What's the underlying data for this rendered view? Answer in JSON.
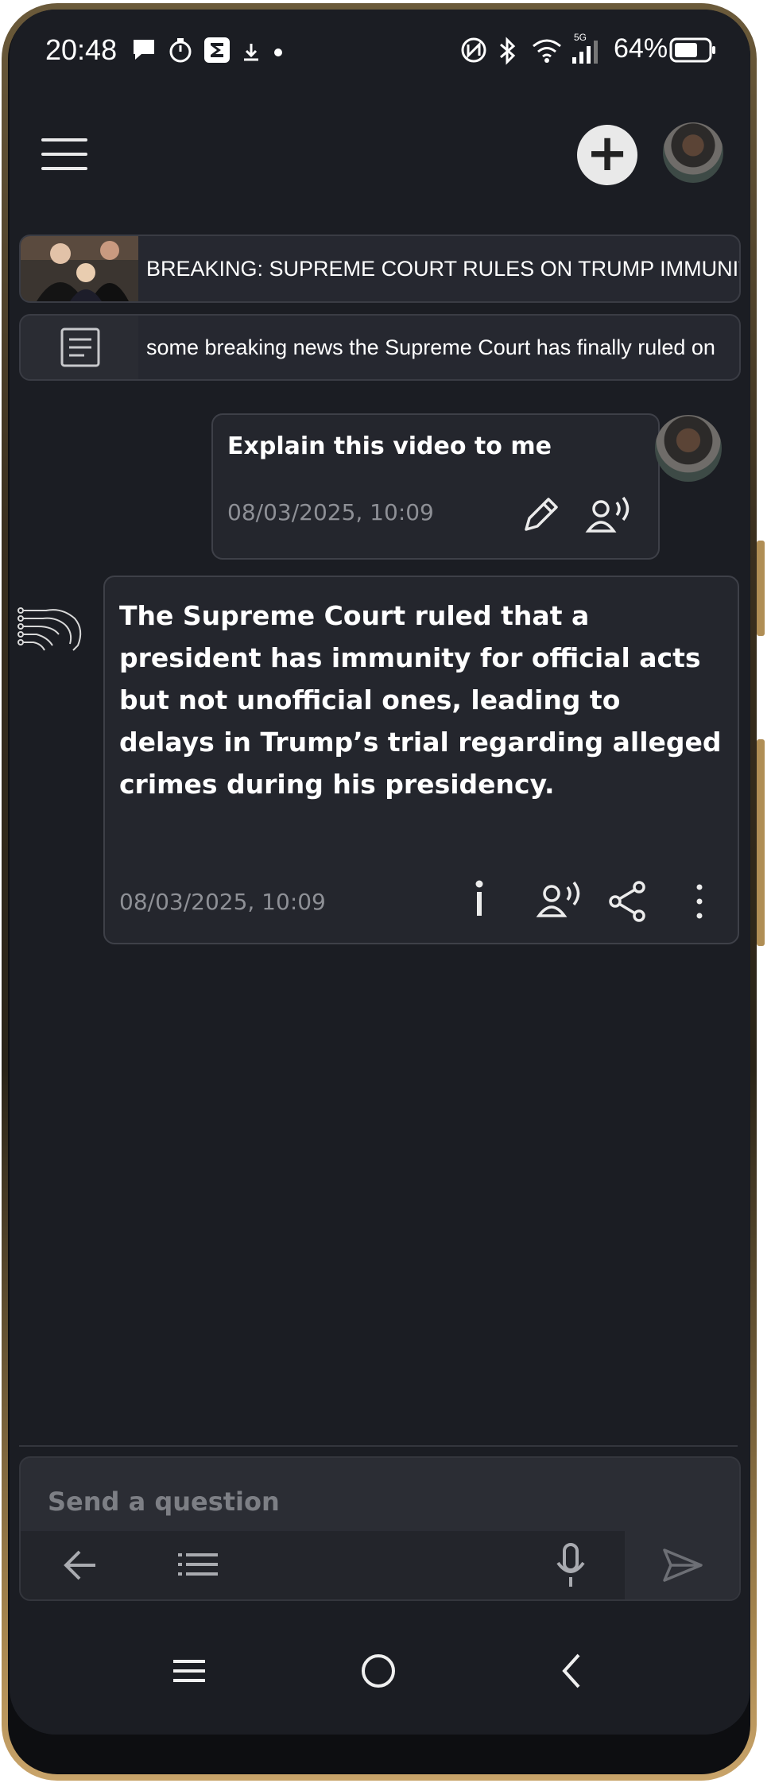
{
  "status_bar": {
    "time": "20:48",
    "network": "5G",
    "battery": "64%"
  },
  "cards": [
    {
      "text": "BREAKING: SUPREME COURT RULES ON TRUMP IMMUNITY"
    },
    {
      "text": "some breaking news the Supreme Court has finally ruled on"
    }
  ],
  "user_message": {
    "text": "Explain this video to me",
    "timestamp": "08/03/2025, 10:09"
  },
  "ai_message": {
    "text": "The Supreme Court ruled that a president has immunity for official acts but not unofficial ones, leading to delays in Trump’s trial regarding alleged crimes during his presidency.",
    "timestamp": "08/03/2025, 10:09"
  },
  "composer": {
    "placeholder": "Send a question"
  },
  "icons": [
    "menu-icon",
    "plus-icon",
    "avatar",
    "document-icon",
    "edit-icon",
    "speaker-icon",
    "ai-logo-icon",
    "info-icon",
    "share-icon",
    "more-icon",
    "back-arrow-icon",
    "list-icon",
    "mic-icon",
    "send-icon",
    "nav-recents-icon",
    "nav-home-icon",
    "nav-back-icon"
  ],
  "colors": {
    "background": "#1b1d23",
    "bubble": "#24262d",
    "frame_gold": "#c9a46a"
  }
}
